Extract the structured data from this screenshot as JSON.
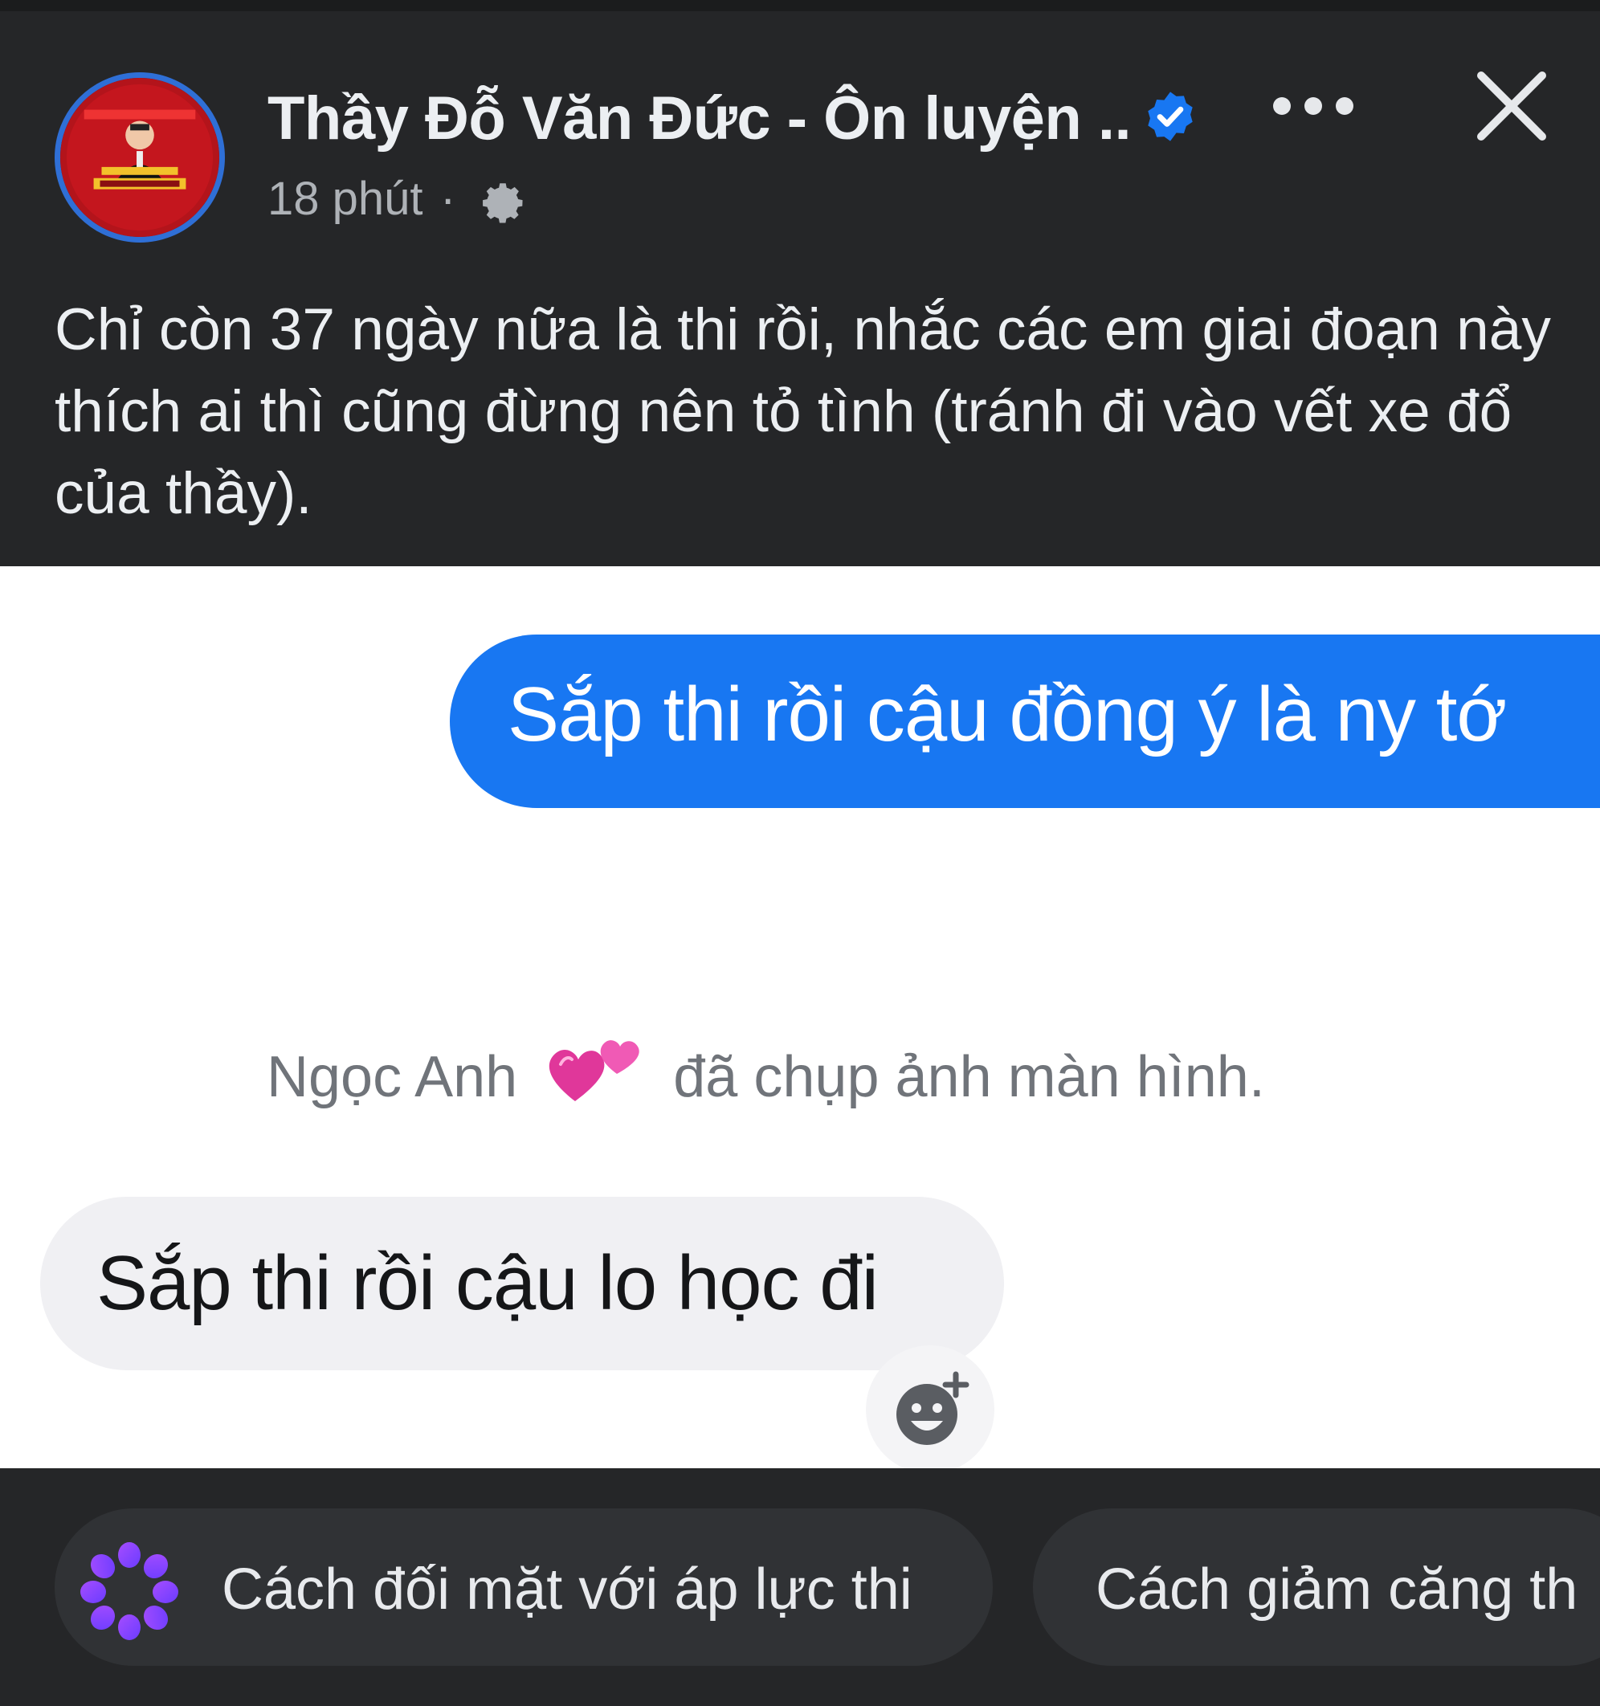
{
  "post": {
    "page_name": "Thầy Đỗ Văn Đức - Ôn luyện ...",
    "time": "18 phút",
    "separator": "·",
    "text": "Chỉ còn 37 ngày nữa là thi rồi, nhắc các em giai đoạn này thích ai thì cũng đừng nên tỏ tình (tránh đi vào vết xe đổ của thầy).",
    "icons": {
      "verified": "verified-badge-icon",
      "more": "more-options-icon",
      "close": "close-icon",
      "audience": "gear-icon"
    }
  },
  "chat": {
    "sent_message": "Sắp thi rồi cậu đồng ý là ny tớ",
    "notice_name": "Ngọc Anh",
    "notice_text": "đã chụp ảnh màn hình.",
    "received_message": "Sắp thi rồi cậu lo học đi"
  },
  "suggestions": [
    {
      "label": "Cách đối mặt với áp lực thi",
      "icon": "ai-sparkle-icon"
    },
    {
      "label": "Cách giảm căng th"
    }
  ],
  "colors": {
    "background_dark": "#252628",
    "sent_bubble": "#1877f2",
    "received_bubble": "#f0f0f3",
    "verified": "#1877f2",
    "chip": "#303235"
  }
}
